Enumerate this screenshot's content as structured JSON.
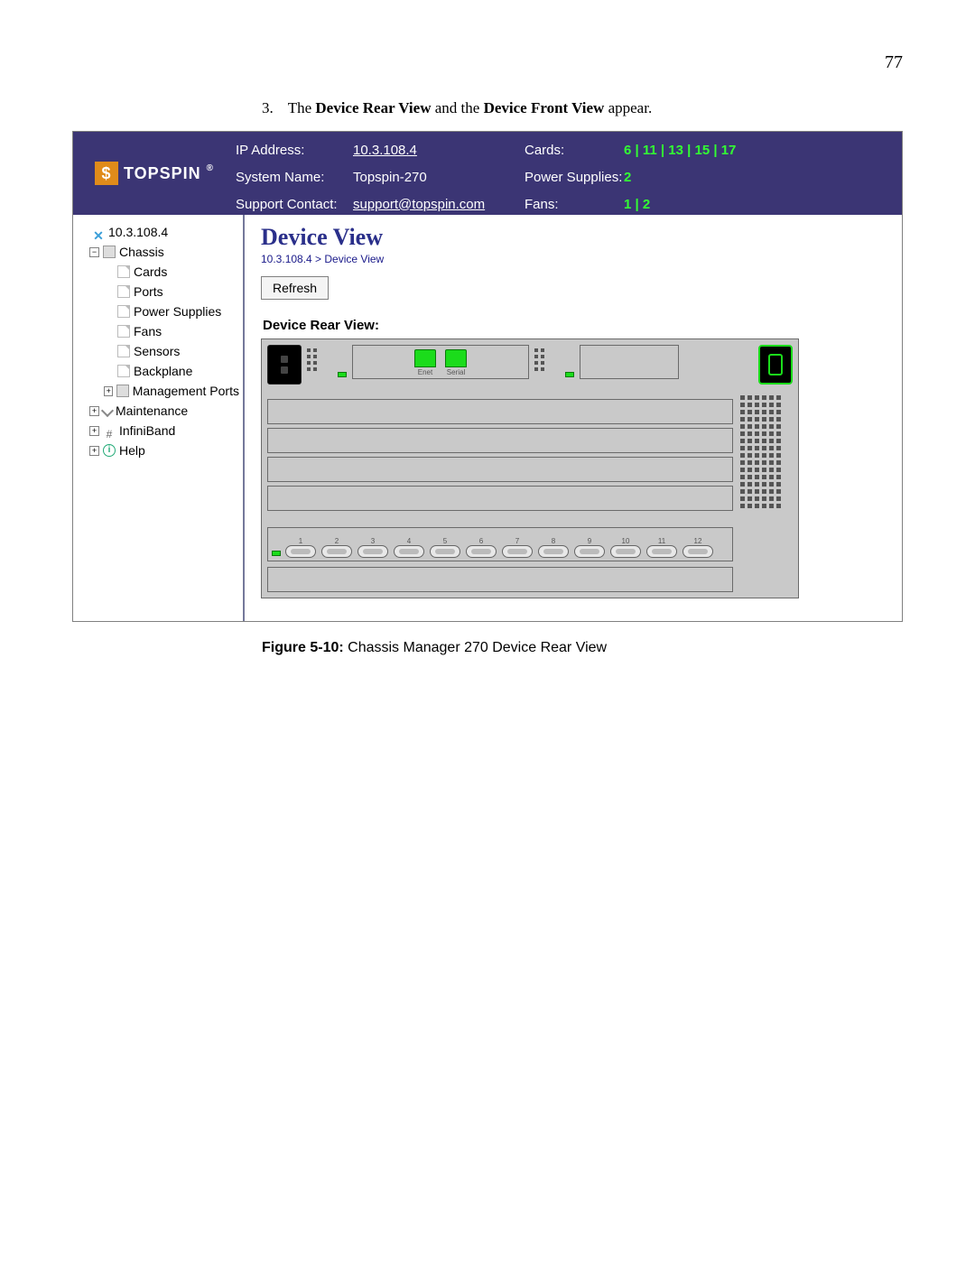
{
  "page": {
    "number": "77"
  },
  "step": {
    "number": "3.",
    "t1": "The ",
    "b1": "Device Rear View",
    "t2": " and the ",
    "b2": "Device Front View",
    "t3": " appear."
  },
  "banner": {
    "brand": "TOPSPIN",
    "ip_label": "IP Address:",
    "ip": "10.3.108.4",
    "sys_label": "System Name:",
    "sys": "Topspin-270",
    "sup_label": "Support Contact:",
    "sup": "support@topspin.com",
    "cards_label": "Cards:",
    "cards": "6 | 11 | 13 | 15 | 17",
    "psu_label": "Power Supplies:",
    "psu": "2",
    "fans_label": "Fans:",
    "fans": "1 | 2"
  },
  "tree": {
    "root": "10.3.108.4",
    "chassis": "Chassis",
    "items": [
      "Cards",
      "Ports",
      "Power Supplies",
      "Fans",
      "Sensors",
      "Backplane",
      "Management Ports"
    ],
    "maintenance": "Maintenance",
    "infiniband": "InfiniBand",
    "help": "Help"
  },
  "content": {
    "title": "Device View",
    "breadcrumb": "10.3.108.4 > Device View",
    "refresh": "Refresh",
    "section": "Device Rear View:"
  },
  "device": {
    "ports_top": [
      "Enet",
      "Serial"
    ],
    "port_numbers": [
      "1",
      "2",
      "3",
      "4",
      "5",
      "6",
      "7",
      "8",
      "9",
      "10",
      "11",
      "12"
    ]
  },
  "caption": {
    "label": "Figure 5-10: ",
    "text": "Chassis Manager 270 Device Rear View"
  }
}
